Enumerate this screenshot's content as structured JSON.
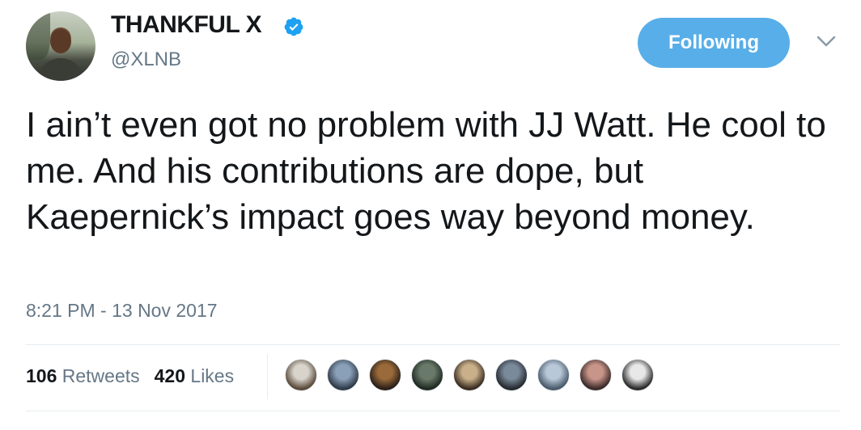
{
  "user": {
    "display_name": "THANKFUL X",
    "handle": "@XLNB",
    "verified": true
  },
  "follow_button": {
    "label": "Following"
  },
  "tweet": {
    "text": "I ain’t even got no problem with JJ Watt. He cool to me. And his contributions are dope, but Kaepernick’s impact goes way beyond money.",
    "timestamp": "8:21 PM - 13 Nov 2017"
  },
  "stats": {
    "retweets_count": "106",
    "retweets_label": "Retweets",
    "likes_count": "420",
    "likes_label": "Likes"
  },
  "colors": {
    "accent": "#58aee8",
    "verified": "#1da1f2",
    "secondary_text": "#657786"
  },
  "likers": [
    {
      "name": "liker-avatar-1",
      "colors": [
        "#d8d4cc",
        "#5a4a3a"
      ]
    },
    {
      "name": "liker-avatar-2",
      "colors": [
        "#8aa0b8",
        "#2f3a48"
      ]
    },
    {
      "name": "liker-avatar-3",
      "colors": [
        "#9a6a3a",
        "#2a1f18"
      ]
    },
    {
      "name": "liker-avatar-4",
      "colors": [
        "#6a7a6a",
        "#1f2a22"
      ]
    },
    {
      "name": "liker-avatar-5",
      "colors": [
        "#c9b08a",
        "#3a2c20"
      ]
    },
    {
      "name": "liker-avatar-6",
      "colors": [
        "#7a8a9a",
        "#262a30"
      ]
    },
    {
      "name": "liker-avatar-7",
      "colors": [
        "#b8c8d8",
        "#4a5a6a"
      ]
    },
    {
      "name": "liker-avatar-8",
      "colors": [
        "#c8958a",
        "#3a2a28"
      ]
    },
    {
      "name": "liker-avatar-9",
      "colors": [
        "#e8e8e8",
        "#2a2a2a"
      ]
    }
  ]
}
